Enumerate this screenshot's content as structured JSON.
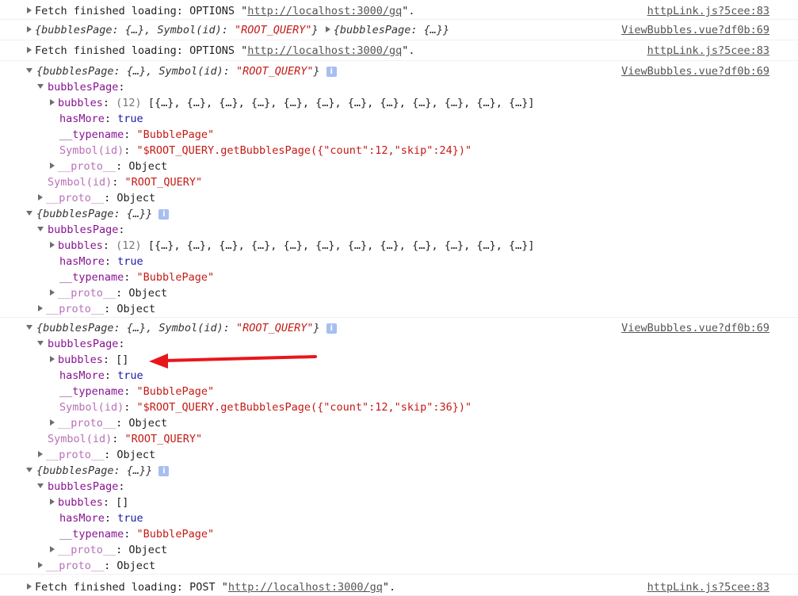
{
  "messages": [
    {
      "prefix": "Fetch finished loading: OPTIONS \"",
      "url": "http://localhost:3000/gq",
      "suffix": "\".",
      "source": "httpLink.js?5cee:83"
    },
    {
      "summary_a": "{bubblesPage: {…}, Symbol(id): ",
      "summary_a_str": "\"ROOT_QUERY\"",
      "summary_a_end": "}",
      "summary_b": "{bubblesPage: {…}}",
      "source": "ViewBubbles.vue?df0b:69"
    },
    {
      "prefix": "Fetch finished loading: OPTIONS \"",
      "url": "http://localhost:3000/gq",
      "suffix": "\".",
      "source": "httpLink.js?5cee:83"
    },
    {
      "summary": "{bubblesPage: {…}, Symbol(id): ",
      "summary_str": "\"ROOT_QUERY\"",
      "summary_end": "}",
      "source": "ViewBubbles.vue?df0b:69",
      "bubbles_page_key": "bubblesPage",
      "bubbles_key": "bubbles",
      "bubbles_count": "(12)",
      "bubbles_value": "[{…}, {…}, {…}, {…}, {…}, {…}, {…}, {…}, {…}, {…}, {…}, {…}]",
      "has_more_key": "hasMore",
      "has_more_value": "true",
      "typename_key": "__typename",
      "typename_value": "\"BubblePage\"",
      "symbol_key": "Symbol(id)",
      "symbol_value": "\"$ROOT_QUERY.getBubblesPage({\"count\":12,\"skip\":24})\"",
      "proto_key": "__proto__",
      "proto_value": "Object",
      "root_symbol_key": "Symbol(id)",
      "root_symbol_value": "\"ROOT_QUERY\"",
      "root_proto_key": "__proto__",
      "root_proto_value": "Object"
    },
    {
      "summary": "{bubblesPage: {…}}",
      "bubbles_page_key": "bubblesPage",
      "bubbles_key": "bubbles",
      "bubbles_count": "(12)",
      "bubbles_value": "[{…}, {…}, {…}, {…}, {…}, {…}, {…}, {…}, {…}, {…}, {…}, {…}]",
      "has_more_key": "hasMore",
      "has_more_value": "true",
      "typename_key": "__typename",
      "typename_value": "\"BubblePage\"",
      "proto_key": "__proto__",
      "proto_value": "Object",
      "root_proto_key": "__proto__",
      "root_proto_value": "Object"
    },
    {
      "summary": "{bubblesPage: {…}, Symbol(id): ",
      "summary_str": "\"ROOT_QUERY\"",
      "summary_end": "}",
      "source": "ViewBubbles.vue?df0b:69",
      "bubbles_page_key": "bubblesPage",
      "bubbles_key": "bubbles",
      "bubbles_value": "[]",
      "has_more_key": "hasMore",
      "has_more_value": "true",
      "typename_key": "__typename",
      "typename_value": "\"BubblePage\"",
      "symbol_key": "Symbol(id)",
      "symbol_value": "\"$ROOT_QUERY.getBubblesPage({\"count\":12,\"skip\":36})\"",
      "proto_key": "__proto__",
      "proto_value": "Object",
      "root_symbol_key": "Symbol(id)",
      "root_symbol_value": "\"ROOT_QUERY\"",
      "root_proto_key": "__proto__",
      "root_proto_value": "Object"
    },
    {
      "summary": "{bubblesPage: {…}}",
      "bubbles_page_key": "bubblesPage",
      "bubbles_key": "bubbles",
      "bubbles_value": "[]",
      "has_more_key": "hasMore",
      "has_more_value": "true",
      "typename_key": "__typename",
      "typename_value": "\"BubblePage\"",
      "proto_key": "__proto__",
      "proto_value": "Object",
      "root_proto_key": "__proto__",
      "root_proto_value": "Object"
    },
    {
      "prefix": "Fetch finished loading: POST \"",
      "url": "http://localhost:3000/gq",
      "suffix": "\".",
      "source": "httpLink.js?5cee:83"
    }
  ],
  "info_badge": "i",
  "colors": {
    "annotation_arrow": "#e8161b",
    "string": "#c41a16",
    "key": "#881391",
    "keyword": "#1a1aa6"
  },
  "icons": {
    "expand": "triangle-right-icon",
    "collapse": "triangle-down-icon",
    "info": "info-icon",
    "annotation": "red-arrow-icon"
  }
}
